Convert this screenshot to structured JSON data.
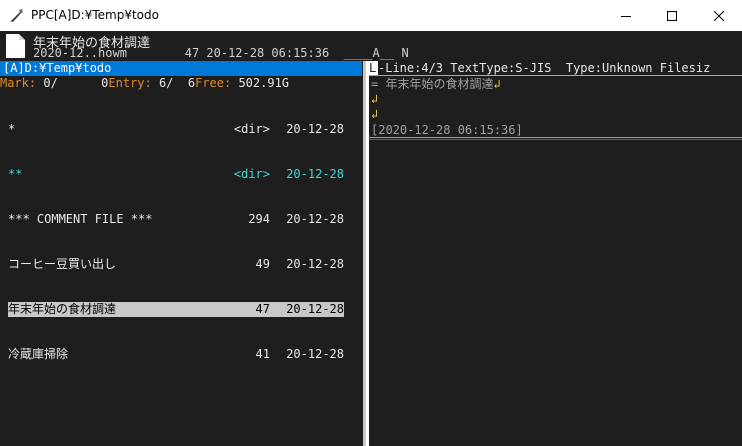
{
  "window": {
    "title": "PPC[A]D:¥Temp¥todo",
    "buttons": {
      "minimize": "minimize",
      "maximize": "maximize",
      "close": "close"
    }
  },
  "info": {
    "line1": "年末年始の食材調達",
    "line2": "2020-12..howm        47 20-12-28 06:15:36  ____A__ N"
  },
  "path": "[A]D:¥Temp¥todo",
  "status": {
    "mark_label": "Mark:",
    "mark_value": " 0/      0",
    "entry_label": "Entry:",
    "entry_value": " 6/  6",
    "free_label": "Free:",
    "free_value": " 502.91G"
  },
  "files": [
    {
      "name": "*",
      "size": "<dir>",
      "date": "20-12-28",
      "color": "white"
    },
    {
      "name": "**",
      "size": "<dir>",
      "date": "20-12-28",
      "color": "cyan"
    },
    {
      "name": "*** COMMENT FILE ***",
      "size": "294",
      "date": "20-12-28",
      "color": "white"
    },
    {
      "name": "コーヒー豆買い出し",
      "size": "49",
      "date": "20-12-28",
      "color": "white"
    },
    {
      "name": "年末年始の食材調達",
      "size": "47",
      "date": "20-12-28",
      "color": "cursor"
    },
    {
      "name": "冷蔵庫掃除",
      "size": "41",
      "date": "20-12-28",
      "color": "white"
    }
  ],
  "viewer": {
    "header_lead": "L",
    "header": "-Line:4/3 TextType:S-JIS  Type:Unknown Filesiz",
    "lines": [
      {
        "text": "= 年末年始の食材調達",
        "mark": "↲"
      },
      {
        "text": "",
        "mark": "↲"
      },
      {
        "text": "",
        "mark": "↲"
      }
    ],
    "timestamp": "[2020-12-28 06:15:36]"
  },
  "colors": {
    "accent": "#0078d7",
    "orange": "#e08a2a",
    "cyan": "#3fd7d7",
    "background": "#1e1e1e"
  }
}
